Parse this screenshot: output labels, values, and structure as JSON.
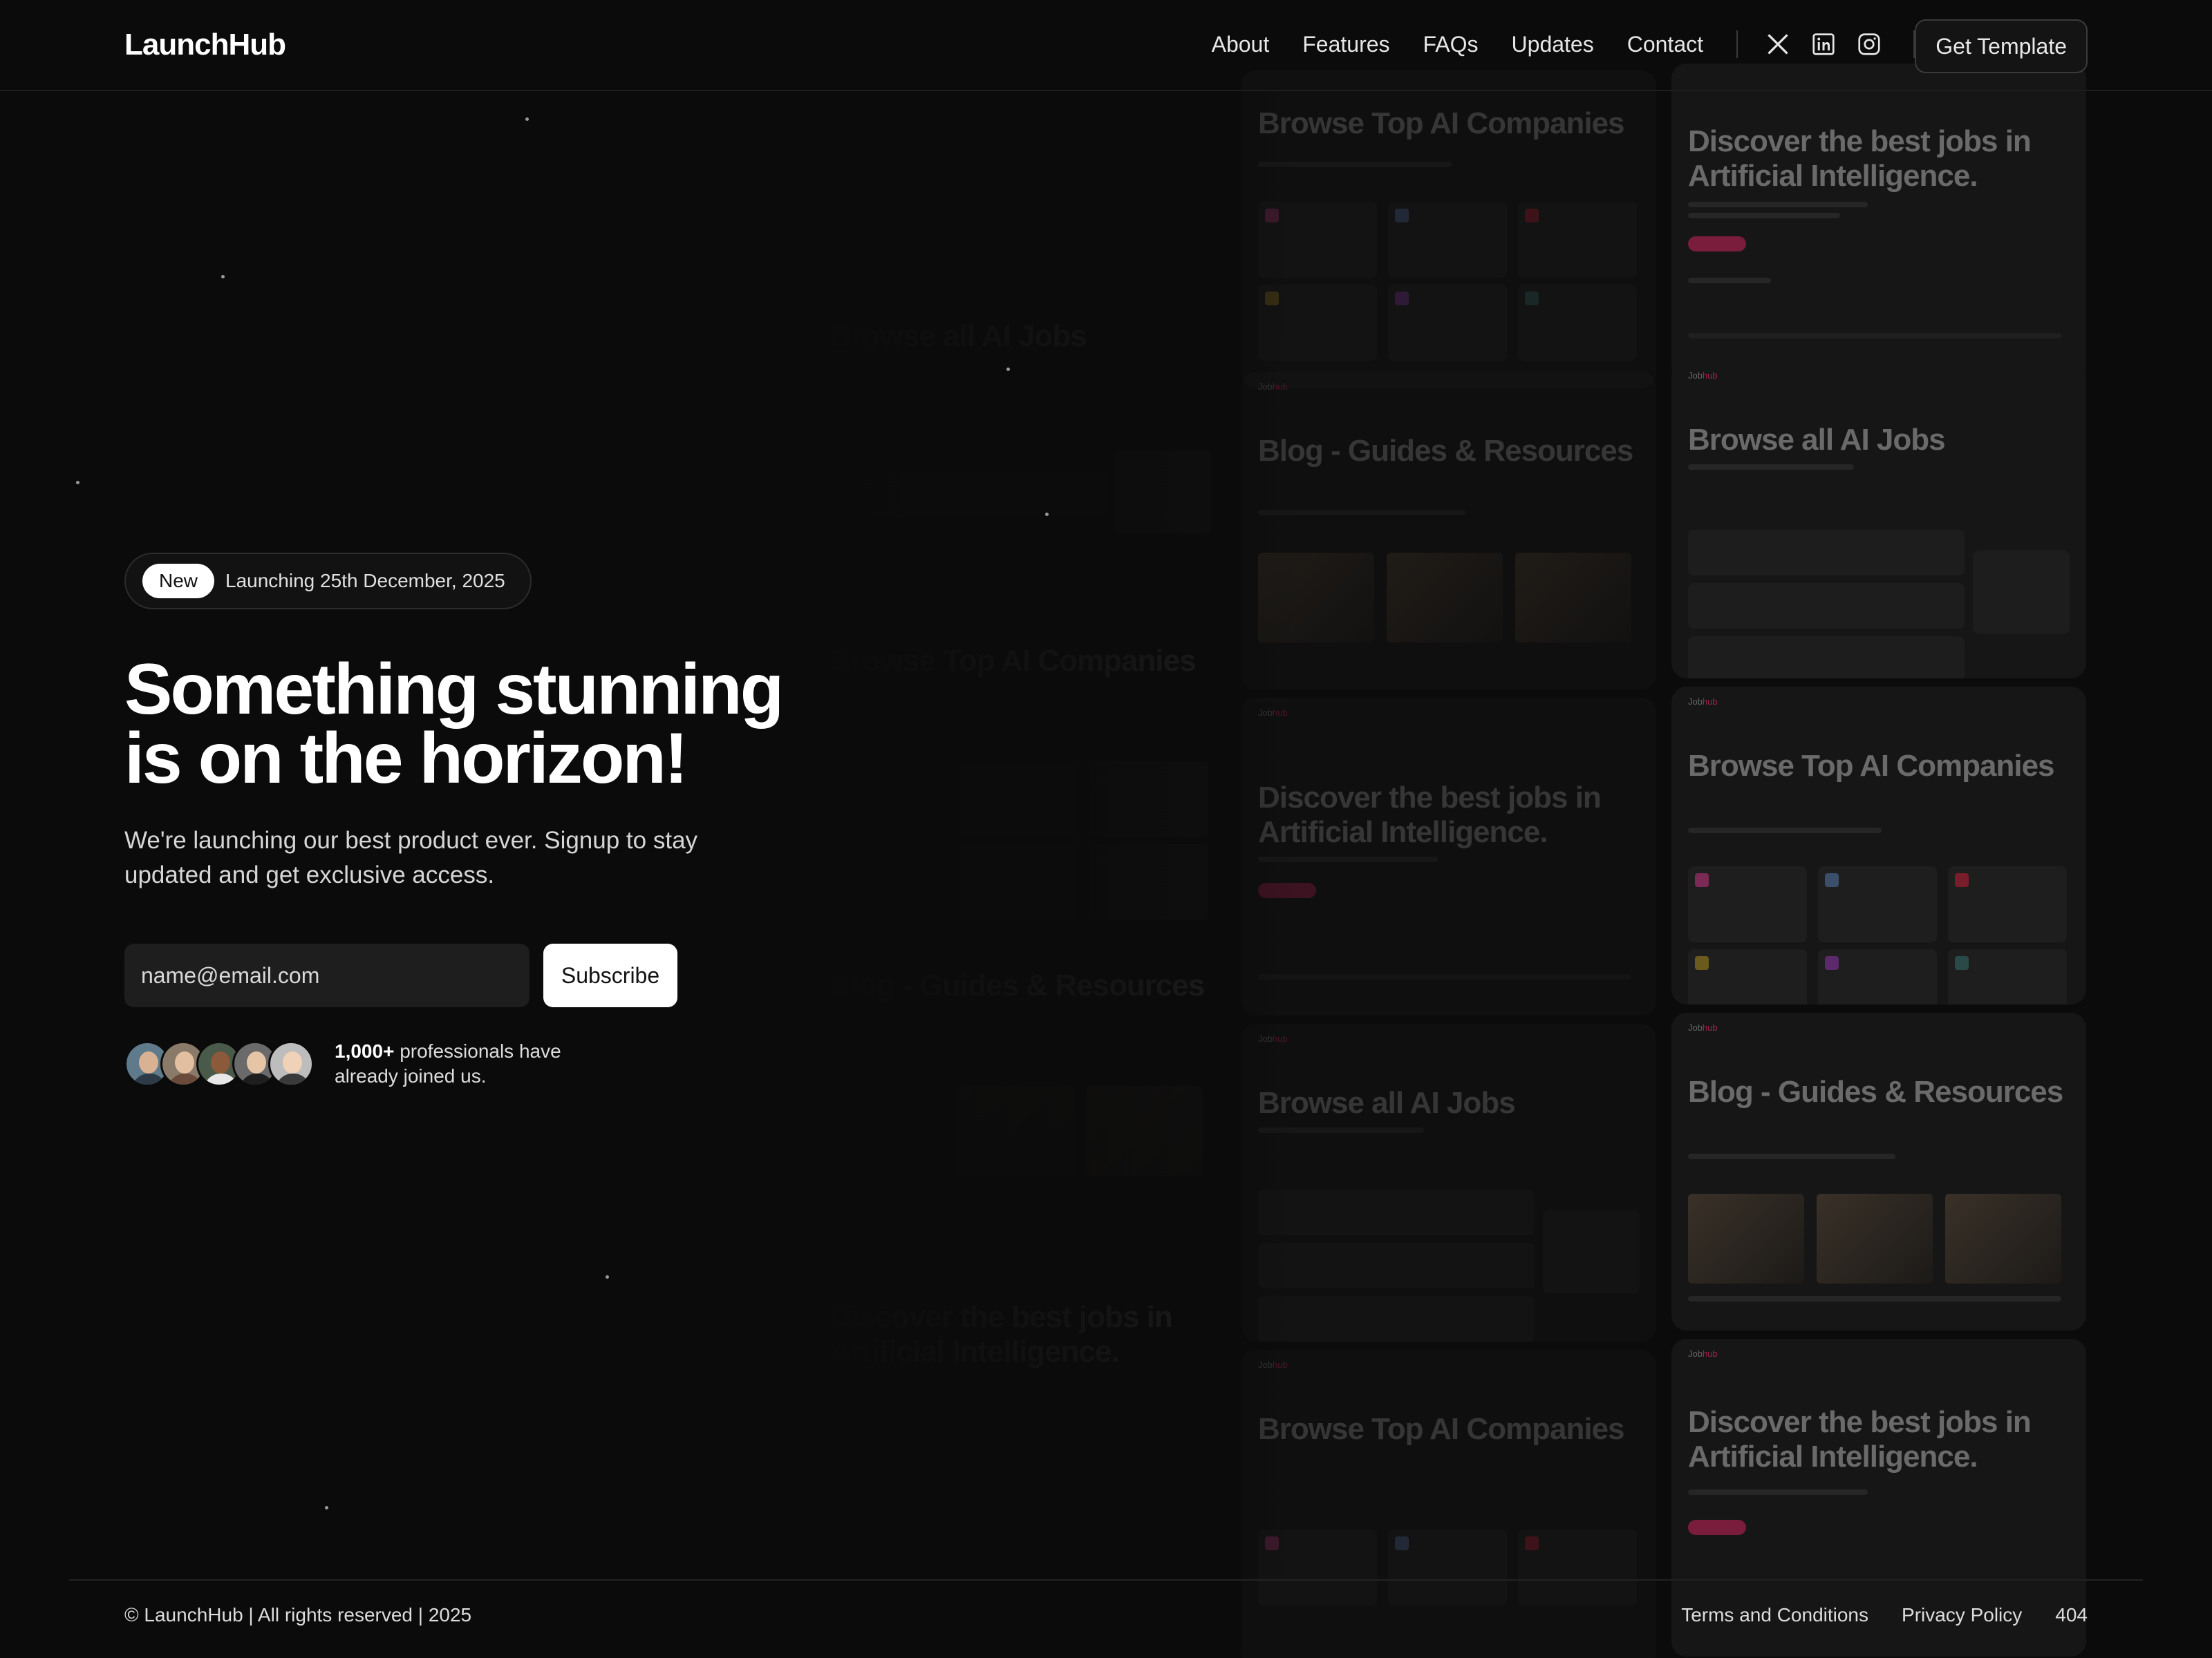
{
  "header": {
    "logo": "LaunchHub",
    "nav": [
      "About",
      "Features",
      "FAQs",
      "Updates",
      "Contact"
    ],
    "social": [
      "x-icon",
      "linkedin-icon",
      "instagram-icon"
    ],
    "cta_label": "Get Template"
  },
  "hero": {
    "badge_tag": "New",
    "badge_text": "Launching 25th December, 2025",
    "headline": "Something stunning is on the horizon!",
    "subtitle": "We're launching our best product ever. Signup to stay updated and get exclusive access.",
    "email_placeholder": "name@email.com",
    "subscribe_label": "Subscribe",
    "proof_bold": "1,000+",
    "proof_rest": " professionals have already joined us."
  },
  "mockups": {
    "brand_prefix": "Job",
    "brand_suffix": "hub",
    "titles": {
      "companies": "Browse Top AI Companies",
      "jobs": "Discover the best jobs in Artificial Intelligence.",
      "blog": "Blog - Guides & Resources",
      "browse": "Browse all AI Jobs"
    }
  },
  "footer": {
    "copyright": "© LaunchHub | All rights reserved | 2025",
    "links": [
      "Terms and Conditions",
      "Privacy Policy",
      "404"
    ]
  },
  "colors": {
    "background": "#0b0b0b",
    "accent": "#a0224a",
    "text": "#ffffff"
  }
}
